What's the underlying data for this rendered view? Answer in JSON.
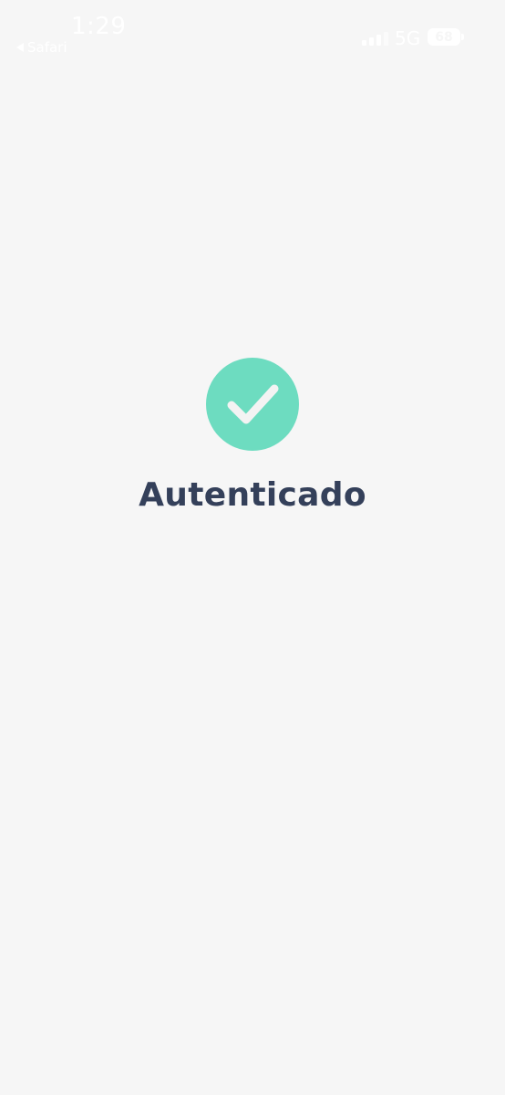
{
  "status_bar": {
    "time": "1:29",
    "back_label": "Safari",
    "network": "5G",
    "battery_level": "68"
  },
  "main": {
    "icon": "checkmark-icon",
    "title": "Autenticado"
  },
  "colors": {
    "background": "#f6f6f6",
    "accent": "#6ddcc0",
    "title_text": "#34405a"
  }
}
